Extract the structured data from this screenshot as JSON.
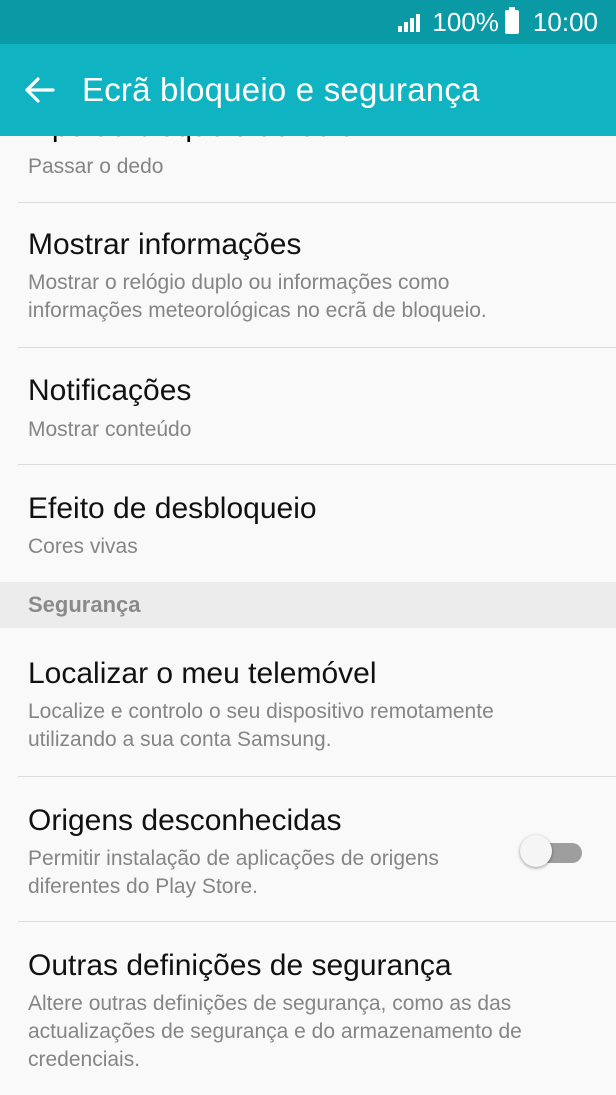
{
  "status_bar": {
    "battery": "100%",
    "time": "10:00",
    "signal_icon": "signal-icon",
    "battery_icon": "battery-icon"
  },
  "app_bar": {
    "title": "Ecrã bloqueio e segurança",
    "back_icon": "back-arrow-icon"
  },
  "list": {
    "cut_off_title": "Tipo de bloqueio do ecrã",
    "items": [
      {
        "subtitle": "Passar o dedo"
      },
      {
        "title": "Mostrar informações",
        "subtitle": "Mostrar o relógio duplo ou informações como informações meteorológicas no ecrã de bloqueio."
      },
      {
        "title": "Notificações",
        "subtitle": "Mostrar conteúdo"
      },
      {
        "title": "Efeito de desbloqueio",
        "subtitle": "Cores vivas"
      }
    ],
    "section": "Segurança",
    "security_items": [
      {
        "title": "Localizar o meu telemóvel",
        "subtitle": "Localize e controlo o seu dispositivo remotamente utilizando a sua conta Samsung."
      },
      {
        "title": "Origens desconhecidas",
        "subtitle": "Permitir instalação de aplicações de origens diferentes do Play Store.",
        "toggle": "off"
      },
      {
        "title": "Outras definições de segurança",
        "subtitle": "Altere outras definições de segurança, como as das actualizações de segurança e do armazenamento de credenciais."
      }
    ]
  },
  "colors": {
    "status_bar": "#0a9aa5",
    "app_bar": "#10b3c1",
    "background": "#f9f9f9",
    "section": "#ececec"
  }
}
